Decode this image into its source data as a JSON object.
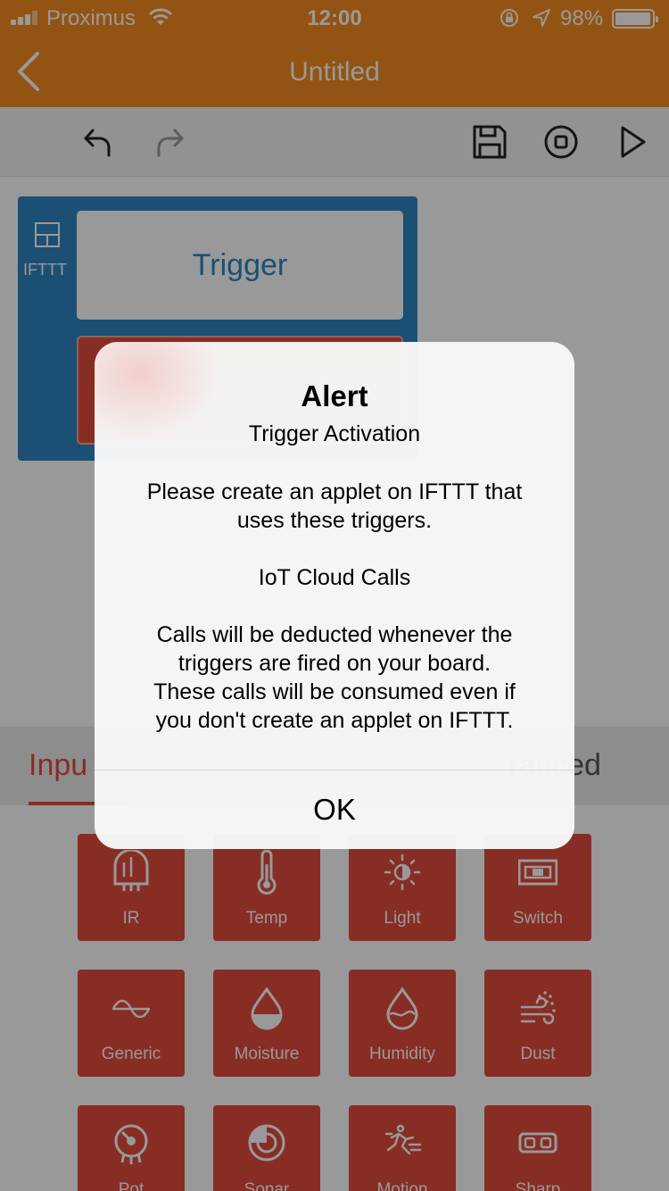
{
  "status_bar": {
    "carrier": "Proximus",
    "time": "12:00",
    "battery_percent": "98%",
    "battery_level": 0.98
  },
  "nav": {
    "title": "Untitled"
  },
  "toolbar": {
    "icons": [
      "undo-icon",
      "redo-icon",
      "save-icon",
      "stop-icon",
      "play-icon"
    ]
  },
  "canvas": {
    "block_label": "IFTTT",
    "trigger_label": "Trigger"
  },
  "tabs": {
    "input_visible": "Inpu",
    "advanced_visible": "ranced"
  },
  "tiles": [
    {
      "label": "IR",
      "icon": "ir-icon"
    },
    {
      "label": "Temp",
      "icon": "thermometer-icon"
    },
    {
      "label": "Light",
      "icon": "light-icon"
    },
    {
      "label": "Switch",
      "icon": "switch-icon"
    },
    {
      "label": "Generic",
      "icon": "generic-wave-icon"
    },
    {
      "label": "Moisture",
      "icon": "moisture-drop-icon"
    },
    {
      "label": "Humidity",
      "icon": "humidity-drop-icon"
    },
    {
      "label": "Dust",
      "icon": "dust-icon"
    },
    {
      "label": "Pot",
      "icon": "potentiometer-icon"
    },
    {
      "label": "Sonar",
      "icon": "sonar-icon"
    },
    {
      "label": "Motion",
      "icon": "motion-icon"
    },
    {
      "label": "Sharp",
      "icon": "sharp-sensor-icon"
    }
  ],
  "alert": {
    "title": "Alert",
    "subtitle": "Trigger Activation",
    "line1": "Please create an applet on IFTTT that",
    "line2": "uses these triggers.",
    "line3": "IoT Cloud Calls",
    "line4": "Calls will be deducted whenever the",
    "line5": "triggers are fired on your board.",
    "line6": "These calls will be consumed even if",
    "line7": "you don't create an applet on IFTTT.",
    "ok_label": "OK"
  },
  "colors": {
    "brand_orange": "#f68b1f",
    "tile_red": "#e34b3c",
    "block_blue": "#2e86c1"
  }
}
